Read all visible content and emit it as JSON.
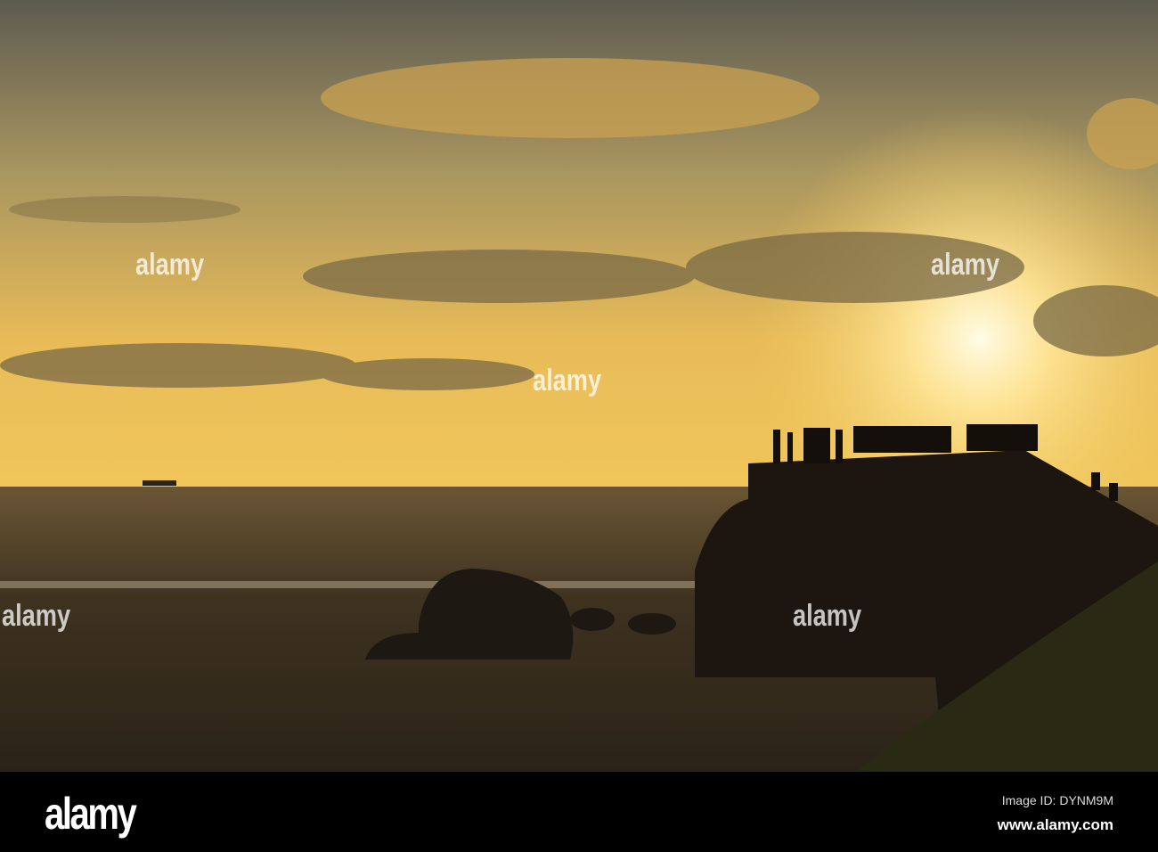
{
  "footer": {
    "logo": "alamy",
    "image_id": "Image ID: DYNM9M",
    "url": "www.alamy.com"
  },
  "watermark": "alamy",
  "colors": {
    "sky_top": "#5a5850",
    "sky_glow": "#f2c860",
    "sun": "#fff6d0",
    "sea": "#2a2218",
    "rock": "#1c1510"
  }
}
